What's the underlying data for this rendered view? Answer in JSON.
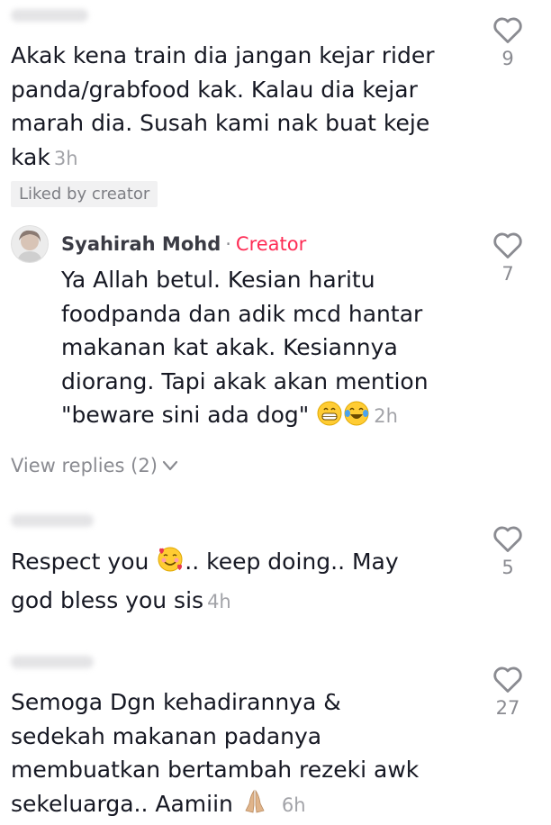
{
  "comments": [
    {
      "text": "Akak kena train dia jangan kejar rider panda/grabfood kak. Kalau dia kejar marah dia. Susah kami nak buat keje kak",
      "time": "3h",
      "likes": "9",
      "badge": "Liked by creator"
    },
    {
      "author": "Syahirah Mohd",
      "dot": "·",
      "role": "Creator",
      "text_line1": "Ya Allah betul. Kesian haritu",
      "text_line2": "foodpanda dan adik mcd hantar",
      "text_line3": "makanan kat akak. Kesiannya",
      "text_line4": "diorang. Tapi akak akan mention",
      "text_line5": "\"beware sini ada dog\"",
      "time": "2h",
      "likes": "7",
      "view_replies": "View replies (2)"
    },
    {
      "text_before_emoji": "Respect you",
      "text_after_emoji": ".. keep doing.. May",
      "text_line2": "god bless you sis",
      "time": "4h",
      "likes": "5"
    },
    {
      "text_line1": "Semoga Dgn kehadirannya &",
      "text_line2": "sedekah makanan padanya",
      "text_line3": "membuatkan bertambah rezeki awk",
      "text_line4": "sekeluarga.. Aamiin",
      "time": "6h",
      "likes": "27"
    }
  ],
  "icons": {
    "like": "heart-outline-icon",
    "chevron": "chevron-down-icon",
    "emoji1": "grinning-face-icon",
    "emoji2": "tears-of-joy-icon",
    "emoji3": "smiling-face-with-hearts-icon",
    "emoji4": "praying-hands-icon"
  },
  "colors": {
    "text": "#161823",
    "muted": "#8a8b91",
    "creator": "#fe2c55"
  }
}
